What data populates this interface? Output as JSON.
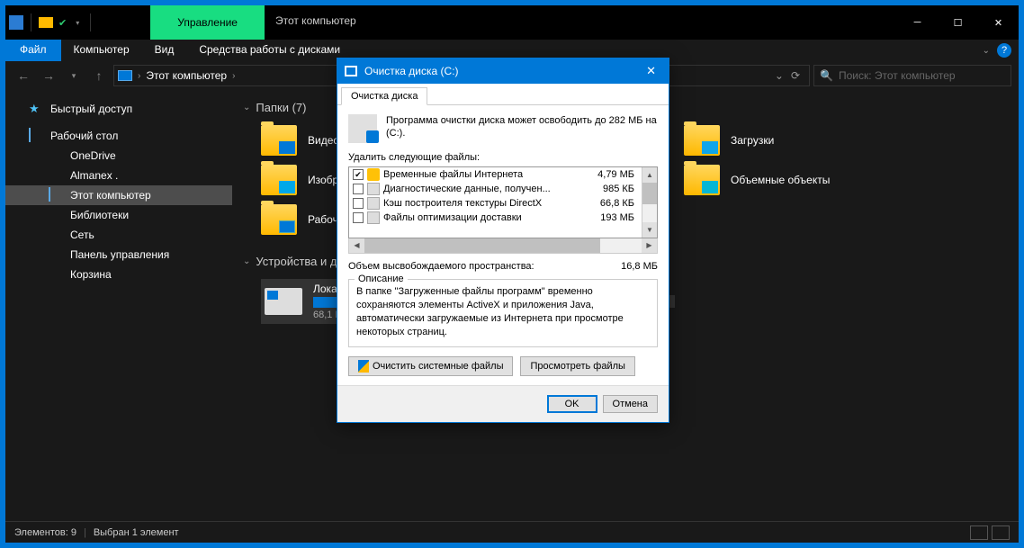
{
  "titlebar": {
    "manage_label": "Управление",
    "title": "Этот компьютер"
  },
  "menubar": {
    "file": "Файл",
    "computer": "Компьютер",
    "view": "Вид",
    "disk_tools": "Средства работы с дисками"
  },
  "address": {
    "location": "Этот компьютер"
  },
  "search": {
    "placeholder": "Поиск: Этот компьютер"
  },
  "sidebar": {
    "quick_access": "Быстрый доступ",
    "desktop": "Рабочий стол",
    "onedrive": "OneDrive",
    "user": "Almanex .",
    "this_pc": "Этот компьютер",
    "libraries": "Библиотеки",
    "network": "Сеть",
    "control_panel": "Панель управления",
    "recycle_bin": "Корзина"
  },
  "content": {
    "folders_header": "Папки (7)",
    "folders": {
      "video": "Видео",
      "images": "Изображ",
      "desktop": "Рабочий",
      "downloads": "Загрузки",
      "objects3d": "Объемные объекты"
    },
    "devices_header": "Устройства и д",
    "drive": {
      "name": "Локальны",
      "free": "68,1 ГБ св"
    }
  },
  "statusbar": {
    "items": "Элементов: 9",
    "selected": "Выбран 1 элемент"
  },
  "dialog": {
    "title": "Очистка диска  (C:)",
    "tab": "Очистка диска",
    "intro": "Программа очистки диска может освободить до 282 МБ на  (C:).",
    "delete_label": "Удалить следующие файлы:",
    "rows": [
      {
        "checked": true,
        "icon": "lock",
        "label": "Временные файлы Интернета",
        "size": "4,79 МБ"
      },
      {
        "checked": false,
        "icon": "file",
        "label": "Диагностические данные, получен...",
        "size": "985 КБ"
      },
      {
        "checked": false,
        "icon": "file",
        "label": "Кэш построителя текстуры DirectX",
        "size": "66,8 КБ"
      },
      {
        "checked": false,
        "icon": "file",
        "label": "Файлы оптимизации доставки",
        "size": "193 МБ"
      }
    ],
    "total_label": "Объем высвобождаемого пространства:",
    "total_value": "16,8 МБ",
    "group_title": "Описание",
    "group_text": "В папке \"Загруженные файлы программ\" временно сохраняются элементы ActiveX и приложения Java, автоматически загружаемые из Интернета при просмотре некоторых страниц.",
    "clean_system": "Очистить системные файлы",
    "view_files": "Просмотреть файлы",
    "ok": "OK",
    "cancel": "Отмена"
  }
}
